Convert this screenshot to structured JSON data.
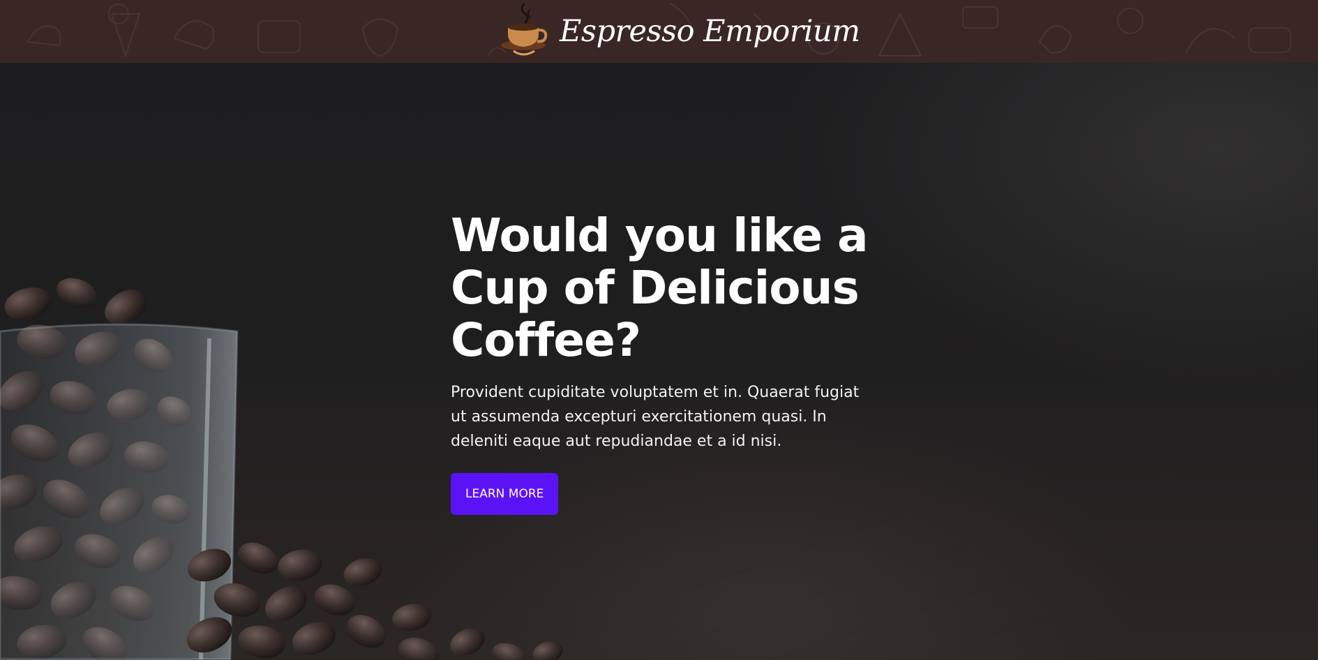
{
  "header": {
    "brand_name": "Espresso Emporium",
    "background_color": "#3a2624",
    "logo_icon": "coffee-cup-icon"
  },
  "hero": {
    "title_line_1": "Would you like a",
    "title_line_2": "Cup of Delicious",
    "title_line_3": "Coffee?",
    "description": "Provident cupiditate voluptatem et in. Quaerat fugiat ut assumenda excepturi exercitationem quasi. In deleniti eaque aut repudiandae et a id nisi.",
    "cta_label": "LEARN MORE",
    "cta_color": "#5b13f5",
    "background_image": "coffee-beans-in-glass"
  }
}
